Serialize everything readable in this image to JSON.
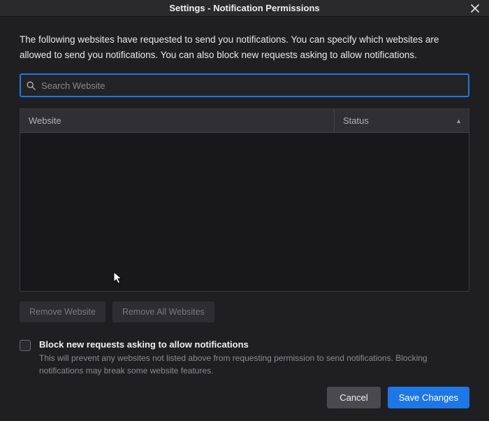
{
  "titlebar": {
    "title": "Settings - Notification Permissions",
    "close_aria": "Close"
  },
  "intro": "The following websites have requested to send you notifications. You can specify which websites are allowed to send you notifications. You can also block new requests asking to allow notifications.",
  "search": {
    "placeholder": "Search Website",
    "value": ""
  },
  "table": {
    "columns": {
      "website": "Website",
      "status": "Status"
    },
    "sort": {
      "column": "status",
      "direction": "asc"
    },
    "rows": []
  },
  "actions": {
    "remove_website": "Remove Website",
    "remove_all": "Remove All Websites"
  },
  "block_new": {
    "checked": false,
    "label": "Block new requests asking to allow notifications",
    "description": "This will prevent any websites not listed above from requesting permission to send notifications. Blocking notifications may break some website features."
  },
  "footer": {
    "cancel": "Cancel",
    "save": "Save Changes"
  }
}
